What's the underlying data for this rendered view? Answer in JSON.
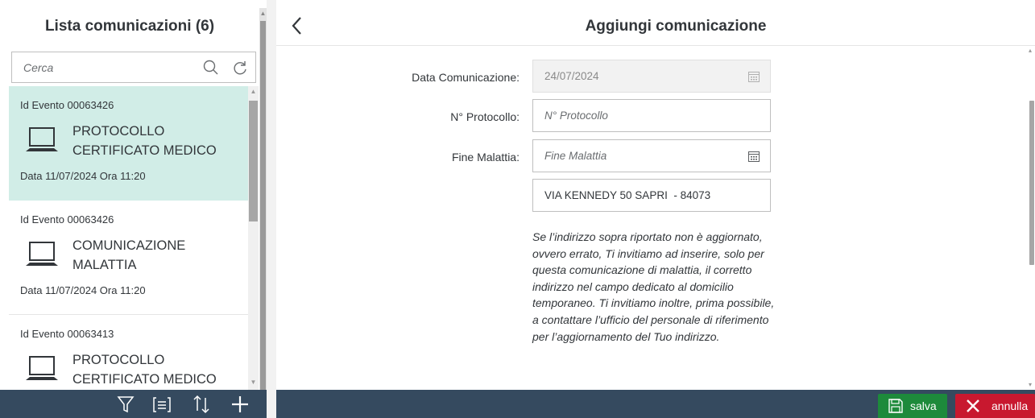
{
  "master": {
    "title": "Lista comunicazioni (6)",
    "search": {
      "placeholder": "Cerca",
      "value": ""
    },
    "items": [
      {
        "event_id": "Id Evento 00063426",
        "title": "PROTOCOLLO CERTIFICATO MEDICO",
        "date": "Data 11/07/2024 Ora 11:20",
        "selected": true
      },
      {
        "event_id": "Id Evento 00063426",
        "title": "COMUNICAZIONE MALATTIA",
        "date": "Data 11/07/2024 Ora 11:20",
        "selected": false
      },
      {
        "event_id": "Id Evento 00063413",
        "title": "PROTOCOLLO CERTIFICATO MEDICO",
        "date": "",
        "selected": false
      }
    ],
    "footer_icons": [
      "filter-icon",
      "group-icon",
      "sort-icon",
      "add-icon"
    ]
  },
  "detail": {
    "title": "Aggiungi comunicazione",
    "form": {
      "data_label": "Data Comunicazione:",
      "data_value": "24/07/2024",
      "protocollo_label": "N° Protocollo:",
      "protocollo_placeholder": "N° Protocollo",
      "fine_label": "Fine Malattia:",
      "fine_placeholder": "Fine Malattia",
      "indirizzo_value": "VIA KENNEDY 50 SAPRI  - 84073",
      "note": "Se l’indirizzo sopra riportato non è aggiornato, ovvero errato, Ti invitiamo ad inserire, solo per questa comunicazione di malattia, il corretto indirizzo nel campo dedicato al domicilio temporaneo. Ti invitiamo inoltre, prima possibile, a contattare l’ufficio del personale di riferimento per l’aggiornamento del Tuo indirizzo."
    },
    "footer": {
      "save_label": "salva",
      "cancel_label": "annulla"
    }
  },
  "colors": {
    "selected_item": "#d1ede7",
    "footer_bar": "#354a5f",
    "save_button": "#1d8a3b",
    "cancel_button": "#c8182f"
  }
}
